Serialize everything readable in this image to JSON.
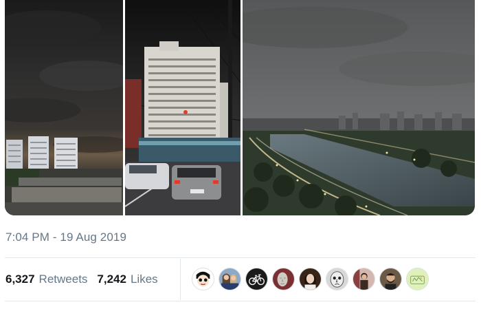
{
  "tweet": {
    "timestamp": "7:04 PM - 19 Aug 2019",
    "retweets": {
      "count": "6,327",
      "label": "Retweets"
    },
    "likes": {
      "count": "7,242",
      "label": "Likes"
    }
  },
  "media": {
    "photos": [
      {
        "name": "dark-storm-sky-over-city"
      },
      {
        "name": "street-with-tall-building-dark-sky"
      },
      {
        "name": "river-highway-dark-cityscape"
      }
    ]
  },
  "likers": [
    {
      "icon": "cartoon-face-avatar",
      "bg": "#ffffff"
    },
    {
      "icon": "two-people-avatar",
      "bg": "#8ea8c8"
    },
    {
      "icon": "bicycle-avatar",
      "bg": "#1a1a1a"
    },
    {
      "icon": "sculpture-face-avatar",
      "bg": "#7a3030"
    },
    {
      "icon": "woman-portrait-avatar",
      "bg": "#3a2418"
    },
    {
      "icon": "sketch-face-avatar",
      "bg": "#d8d8d8"
    },
    {
      "icon": "person-photo-avatar",
      "bg": "#9a6a6a"
    },
    {
      "icon": "bearded-man-avatar",
      "bg": "#6b5a48"
    },
    {
      "icon": "pastel-drawing-avatar",
      "bg": "#dff0b8"
    }
  ],
  "colors": {
    "muted_text": "#657786",
    "divider": "#e1e8ed",
    "text": "#14171a"
  }
}
